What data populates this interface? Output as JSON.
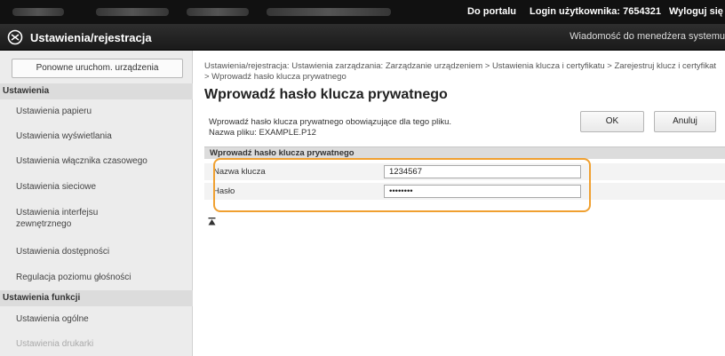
{
  "topbar": {
    "portal_link": "Do portalu",
    "user_label": "Login użytkownika: 7654321",
    "logout_link": "Wyloguj się"
  },
  "titlebar": {
    "title": "Ustawienia/rejestracja",
    "message_link": "Wiadomość do menedżera systemu"
  },
  "sidebar": {
    "restart_button": "Ponowne uruchom. urządzenia",
    "section_settings": "Ustawienia",
    "items": [
      {
        "label": "Ustawienia papieru"
      },
      {
        "label": "Ustawienia wyświetlania"
      },
      {
        "label": "Ustawienia włącznika czasowego"
      },
      {
        "label": "Ustawienia sieciowe"
      },
      {
        "label": "Ustawienia interfejsu zewnętrznego"
      },
      {
        "label": "Ustawienia dostępności"
      },
      {
        "label": "Regulacja poziomu głośności"
      }
    ],
    "section_functions": "Ustawienia funkcji",
    "func_items": [
      {
        "label": "Ustawienia ogólne"
      },
      {
        "label": "Ustawienia drukarki"
      }
    ]
  },
  "main": {
    "breadcrumb": "Ustawienia/rejestracja: Ustawienia zarządzania: Zarządzanie urządzeniem > Ustawienia klucza i certyfikatu > Zarejestruj klucz i certyfikat > Wprowadź hasło klucza prywatnego",
    "page_title": "Wprowadź hasło klucza prywatnego",
    "description": "Wprowadź hasło klucza prywatnego obowiązujące dla tego pliku.",
    "file_name": "Nazwa pliku: EXAMPLE.P12",
    "ok_button": "OK",
    "cancel_button": "Anuluj",
    "panel_title": "Wprowadź hasło klucza prywatnego",
    "key_name_label": "Nazwa klucza",
    "key_name_value": "1234567",
    "password_label": "Hasło",
    "password_value": "••••••••"
  },
  "colors": {
    "highlight": "#f0a030",
    "topbar": "#111111",
    "sidebar_bg": "#ececec"
  }
}
